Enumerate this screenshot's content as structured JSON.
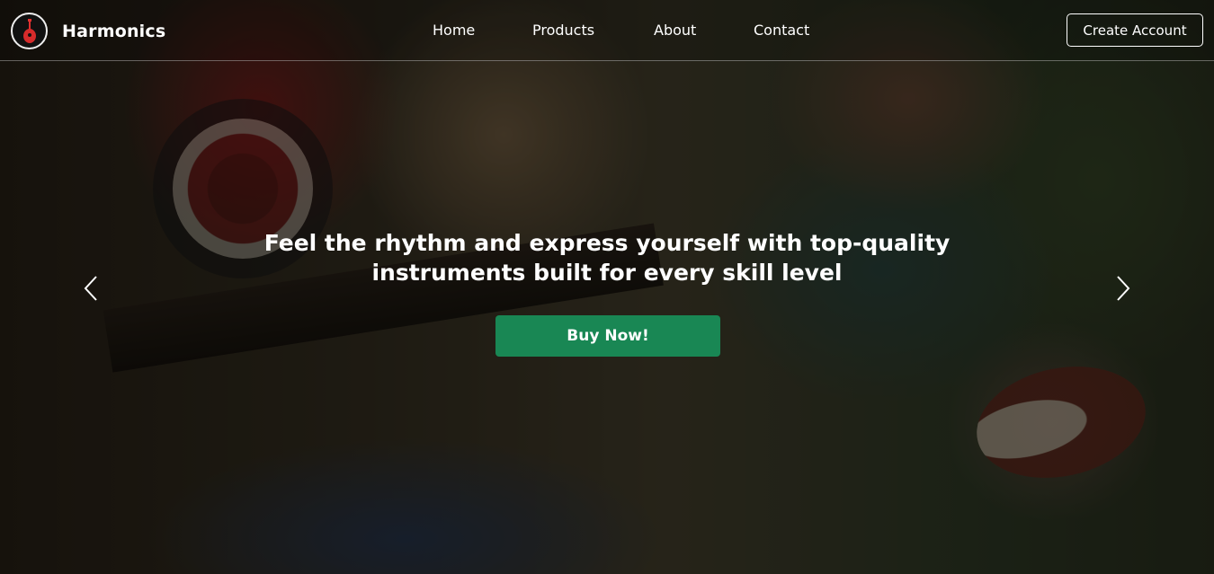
{
  "brand": {
    "name": "Harmonics",
    "logo_icon": "guitar-icon"
  },
  "nav": {
    "items": [
      {
        "label": "Home"
      },
      {
        "label": "Products"
      },
      {
        "label": "About"
      },
      {
        "label": "Contact"
      }
    ],
    "cta_label": "Create Account"
  },
  "hero": {
    "headline_line1": "Feel the rhythm and express yourself with top-quality",
    "headline_line2": "instruments built for every skill level",
    "button_label": "Buy Now!",
    "prev_icon": "chevron-left-icon",
    "next_icon": "chevron-right-icon"
  },
  "colors": {
    "accent": "#198754",
    "logo_red": "#d62b2b",
    "text": "#ffffff"
  }
}
